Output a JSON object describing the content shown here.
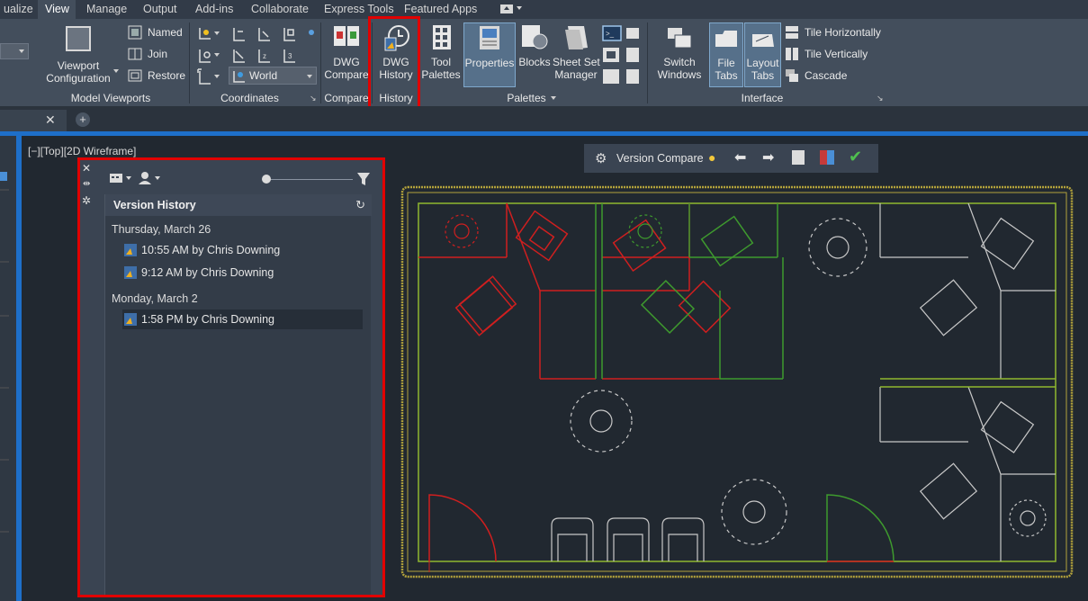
{
  "tabs": [
    "ualize",
    "View",
    "Manage",
    "Output",
    "Add-ins",
    "Collaborate",
    "Express Tools",
    "Featured Apps"
  ],
  "active_tab": "View",
  "ribbon": {
    "model_viewports": {
      "viewport_config_label": "Viewport\nConfiguration",
      "named": "Named",
      "join": "Join",
      "restore": "Restore",
      "panel_label": "Model Viewports"
    },
    "coordinates": {
      "ucs_value": "World",
      "panel_label": "Coordinates"
    },
    "compare": {
      "dwg_compare_label": "DWG\nCompare",
      "panel_label": "Compare"
    },
    "history": {
      "dwg_history_label": "DWG\nHistory",
      "panel_label": "History"
    },
    "palettes": {
      "tool_palettes": "Tool\nPalettes",
      "properties": "Properties",
      "blocks": "Blocks",
      "sheet_set_manager": "Sheet Set\nManager",
      "panel_label": "Palettes"
    },
    "interface": {
      "switch_windows": "Switch\nWindows",
      "file_tabs": "File\nTabs",
      "layout_tabs": "Layout\nTabs",
      "tile_horizontally": "Tile Horizontally",
      "tile_vertically": "Tile Vertically",
      "cascade": "Cascade",
      "panel_label": "Interface"
    }
  },
  "viewport_label": "[−][Top][2D Wireframe]",
  "version_history": {
    "title": "Version History",
    "groups": [
      {
        "date": "Thursday, March 26",
        "items": [
          "10:55 AM by Chris Downing",
          "9:12 AM by Chris Downing"
        ]
      },
      {
        "date": "Monday, March 2",
        "items": [
          "1:58 PM by Chris Downing"
        ]
      }
    ],
    "selected_item": "1:58 PM by Chris Downing"
  },
  "version_compare": {
    "label": "Version Compare"
  },
  "colors": {
    "highlight": "#e10000",
    "ribbon_bg": "#434e5c",
    "canvas_bg": "#212830",
    "accent_blue": "#1e6fc9",
    "drawing_green": "#8fb72f",
    "drawing_red": "#d01f1f"
  }
}
